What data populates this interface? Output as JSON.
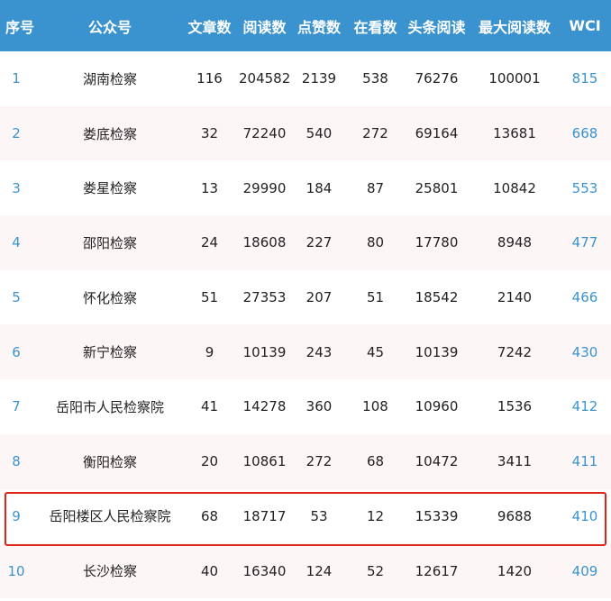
{
  "colors": {
    "header_bg": "#3a93cf",
    "header_text": "#ffffff",
    "link_blue": "#3a93cf",
    "alt_row_bg": "#fdf6f7",
    "highlight_border": "#e0231c"
  },
  "table": {
    "headers": [
      "序号",
      "公众号",
      "文章数",
      "阅读数",
      "点赞数",
      "在看数",
      "头条阅读",
      "最大阅读数",
      "WCI"
    ],
    "rows": [
      [
        "1",
        "湖南检察",
        "116",
        "204582",
        "2139",
        "538",
        "76276",
        "100001",
        "815"
      ],
      [
        "2",
        "娄底检察",
        "32",
        "72240",
        "540",
        "272",
        "69164",
        "13681",
        "668"
      ],
      [
        "3",
        "娄星检察",
        "13",
        "29990",
        "184",
        "87",
        "25801",
        "10842",
        "553"
      ],
      [
        "4",
        "邵阳检察",
        "24",
        "18608",
        "227",
        "80",
        "17780",
        "8948",
        "477"
      ],
      [
        "5",
        "怀化检察",
        "51",
        "27353",
        "207",
        "51",
        "18542",
        "2140",
        "466"
      ],
      [
        "6",
        "新宁检察",
        "9",
        "10139",
        "243",
        "45",
        "10139",
        "7242",
        "430"
      ],
      [
        "7",
        "岳阳市人民检察院",
        "41",
        "14278",
        "360",
        "108",
        "10960",
        "1536",
        "412"
      ],
      [
        "8",
        "衡阳检察",
        "20",
        "10861",
        "272",
        "68",
        "10472",
        "3411",
        "411"
      ],
      [
        "9",
        "岳阳楼区人民检察院",
        "68",
        "18717",
        "53",
        "12",
        "15339",
        "9688",
        "410"
      ],
      [
        "10",
        "长沙检察",
        "40",
        "16340",
        "124",
        "52",
        "12617",
        "1420",
        "409"
      ]
    ],
    "highlighted_row": 9
  }
}
